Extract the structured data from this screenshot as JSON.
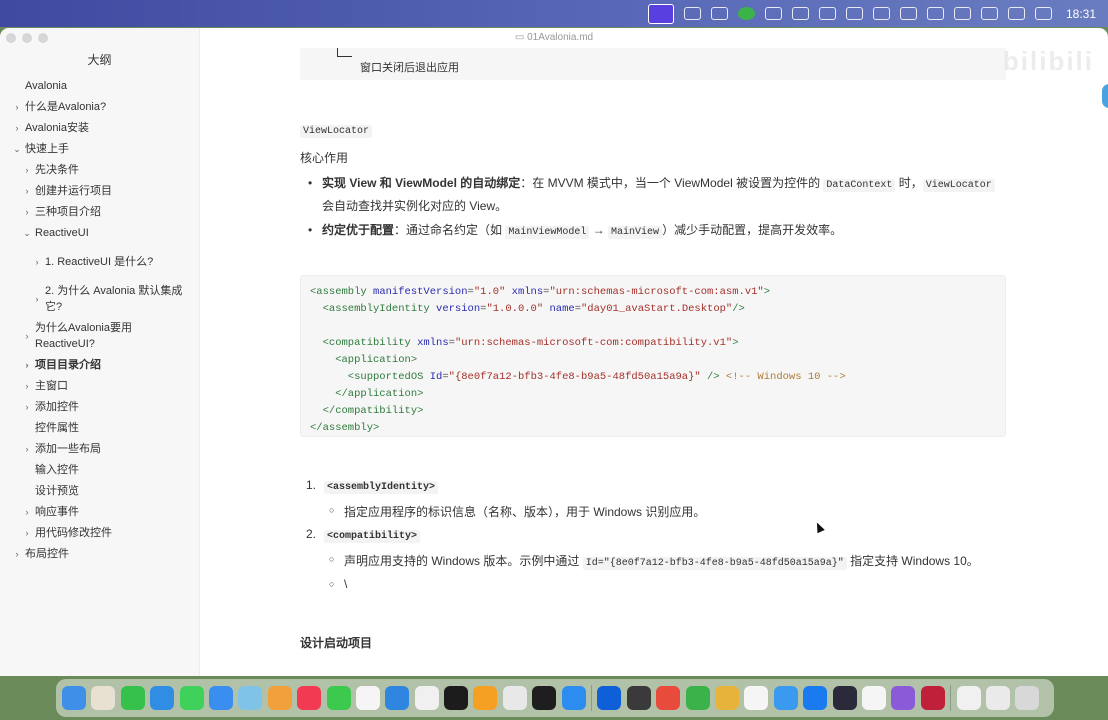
{
  "menubar": {
    "apple": "",
    "tray_icons": [
      "screen-share-icon",
      "creative-cloud-icon",
      "qq-penguin-icon",
      "leaf-app-icon",
      "display-icon",
      "at-sign-icon",
      "teamviewer-icon",
      "screen-mirror-icon",
      "mountain-icon",
      "vpn-icon",
      "input-method-icon",
      "battery-icon",
      "wifi-icon",
      "search-icon",
      "control-center-icon"
    ],
    "time": "18:31"
  },
  "window": {
    "title": "01Avalonia.md",
    "watermark": "bilibili"
  },
  "sidebar": {
    "title": "大纲",
    "items": [
      {
        "label": "Avalonia",
        "level": 0,
        "chev": ""
      },
      {
        "label": "什么是Avalonia?",
        "level": 0,
        "chev": "›"
      },
      {
        "label": "Avalonia安装",
        "level": 0,
        "chev": "›"
      },
      {
        "label": "快速上手",
        "level": 0,
        "chev": "⌄"
      },
      {
        "label": "先决条件",
        "level": 1,
        "chev": "›"
      },
      {
        "label": "创建并运行项目",
        "level": 1,
        "chev": "›"
      },
      {
        "label": "三种项目介绍",
        "level": 1,
        "chev": "›"
      },
      {
        "label": "ReactiveUI",
        "level": 1,
        "chev": "⌄"
      },
      {
        "label": "1. ReactiveUI 是什么?",
        "level": 2,
        "chev": "›"
      },
      {
        "label": "2. 为什么 Avalonia 默认集成它?",
        "level": 2,
        "chev": "›"
      },
      {
        "label": "为什么Avalonia要用ReactiveUI?",
        "level": 1,
        "chev": "›"
      },
      {
        "label": "项目目录介绍",
        "level": 1,
        "chev": "›",
        "bold": true
      },
      {
        "label": "主窗口",
        "level": 1,
        "chev": "›"
      },
      {
        "label": "添加控件",
        "level": 1,
        "chev": "›"
      },
      {
        "label": "控件属性",
        "level": 1,
        "chev": ""
      },
      {
        "label": "添加一些布局",
        "level": 1,
        "chev": "›"
      },
      {
        "label": "输入控件",
        "level": 1,
        "chev": ""
      },
      {
        "label": "设计预览",
        "level": 1,
        "chev": ""
      },
      {
        "label": "响应事件",
        "level": 1,
        "chev": "›"
      },
      {
        "label": "用代码修改控件",
        "level": 1,
        "chev": "›"
      },
      {
        "label": "布局控件",
        "level": 0,
        "chev": "›"
      }
    ]
  },
  "content": {
    "tree_line": "窗口关闭后退出应用",
    "viewlocator": "ViewLocator",
    "core_role": "核心作用",
    "bullet1": {
      "bold": "实现 View 和 ViewModel 的自动绑定",
      "t1": "：在 MVVM 模式中，当一个 ViewModel 被设置为控件的 ",
      "c1": "DataContext",
      "t2": " 时，",
      "c2": "ViewLocator",
      "t3": " 会自动查找并实例化对应的 View。"
    },
    "bullet2": {
      "bold": "约定优于配置",
      "t1": "：通过命名约定（如 ",
      "c1": "MainViewModel",
      "t2": " → ",
      "c2": "MainView",
      "t3": "）减少手动配置，提高开发效率。"
    },
    "code_lines": [
      [
        [
          "tag",
          "<assembly "
        ],
        [
          "attr",
          "manifestVersion"
        ],
        [
          "p",
          "="
        ],
        [
          "str",
          "\"1.0\" "
        ],
        [
          "attr",
          "xmlns"
        ],
        [
          "p",
          "="
        ],
        [
          "str",
          "\"urn:schemas-microsoft-com:asm.v1\""
        ],
        [
          "tag",
          ">"
        ]
      ],
      [
        [
          "tag",
          "  <assemblyIdentity "
        ],
        [
          "attr",
          "version"
        ],
        [
          "p",
          "="
        ],
        [
          "str",
          "\"1.0.0.0\" "
        ],
        [
          "attr",
          "name"
        ],
        [
          "p",
          "="
        ],
        [
          "str",
          "\"day01_avaStart.Desktop\""
        ],
        [
          "tag",
          "/>"
        ]
      ],
      [
        [
          "p",
          " "
        ]
      ],
      [
        [
          "tag",
          "  <compatibility "
        ],
        [
          "attr",
          "xmlns"
        ],
        [
          "p",
          "="
        ],
        [
          "str",
          "\"urn:schemas-microsoft-com:compatibility.v1\""
        ],
        [
          "tag",
          ">"
        ]
      ],
      [
        [
          "tag",
          "    <application>"
        ]
      ],
      [
        [
          "tag",
          "      <supportedOS "
        ],
        [
          "attr",
          "Id"
        ],
        [
          "p",
          "="
        ],
        [
          "str",
          "\"{8e0f7a12-bfb3-4fe8-b9a5-48fd50a15a9a}\""
        ],
        [
          "tag",
          " /> "
        ],
        [
          "com",
          "<!-- Windows 10 -->"
        ]
      ],
      [
        [
          "tag",
          "    </application>"
        ]
      ],
      [
        [
          "tag",
          "  </compatibility>"
        ]
      ],
      [
        [
          "tag",
          "</assembly>"
        ]
      ]
    ],
    "list": [
      {
        "num": "1.",
        "code": "<assemblyIdentity>",
        "subs": [
          {
            "t1": "指定应用程序的标识信息（名称、版本），用于 Windows 识别应用。"
          }
        ]
      },
      {
        "num": "2.",
        "code": "<compatibility>",
        "subs": [
          {
            "t1": "声明应用支持的 Windows 版本。示例中通过 ",
            "c": "Id=\"{8e0f7a12-bfb3-4fe8-b9a5-48fd50a15a9a}\"",
            "t2": " 指定支持 Windows 10。"
          },
          {
            "t1": "\\"
          }
        ]
      }
    ],
    "heading": "设计启动项目"
  },
  "dock": {
    "apps": [
      {
        "name": "finder",
        "color": "#3d8fe8"
      },
      {
        "name": "launchpad",
        "color": "#e8e0d0"
      },
      {
        "name": "numbers",
        "color": "#35c14b"
      },
      {
        "name": "safari",
        "color": "#2f8de4"
      },
      {
        "name": "messages",
        "color": "#3fd15a"
      },
      {
        "name": "mail",
        "color": "#3a8ef0"
      },
      {
        "name": "maps",
        "color": "#7fc4e8"
      },
      {
        "name": "photos",
        "color": "#f2a03c"
      },
      {
        "name": "music",
        "color": "#f23b52"
      },
      {
        "name": "facetime",
        "color": "#3cc94e"
      },
      {
        "name": "reminders",
        "color": "#f5f5f5"
      },
      {
        "name": "keynote",
        "color": "#2f86e0"
      },
      {
        "name": "freeform",
        "color": "#f0f0f0"
      },
      {
        "name": "apple-tv",
        "color": "#1c1c1c"
      },
      {
        "name": "pages",
        "color": "#f5a023"
      },
      {
        "name": "iphone-mirroring",
        "color": "#e8e8e8"
      },
      {
        "name": "terminal",
        "color": "#1e1e1e"
      },
      {
        "name": "app-store",
        "color": "#2d8cf0"
      },
      {
        "sep": true
      },
      {
        "name": "teamviewer",
        "color": "#0e5fd8"
      },
      {
        "name": "quicktime",
        "color": "#3a3a3a"
      },
      {
        "name": "wps",
        "color": "#e84a3c"
      },
      {
        "name": "leaf-app",
        "color": "#3bb34a"
      },
      {
        "name": "chrome",
        "color": "#e8b33a"
      },
      {
        "name": "qq",
        "color": "#f5f5f5"
      },
      {
        "name": "lark",
        "color": "#3a9af0"
      },
      {
        "name": "tencent-meeting",
        "color": "#1a7af0"
      },
      {
        "name": "obs",
        "color": "#2a2a3a"
      },
      {
        "name": "typora",
        "color": "#f5f5f5"
      },
      {
        "name": "visual-studio",
        "color": "#8a5ad8"
      },
      {
        "name": "rider",
        "color": "#c0203a"
      },
      {
        "sep": true
      },
      {
        "name": "document",
        "color": "#f0f0f0"
      },
      {
        "name": "screenshot",
        "color": "#eaeaea"
      },
      {
        "name": "trash",
        "color": "#d8d8d8"
      }
    ]
  }
}
